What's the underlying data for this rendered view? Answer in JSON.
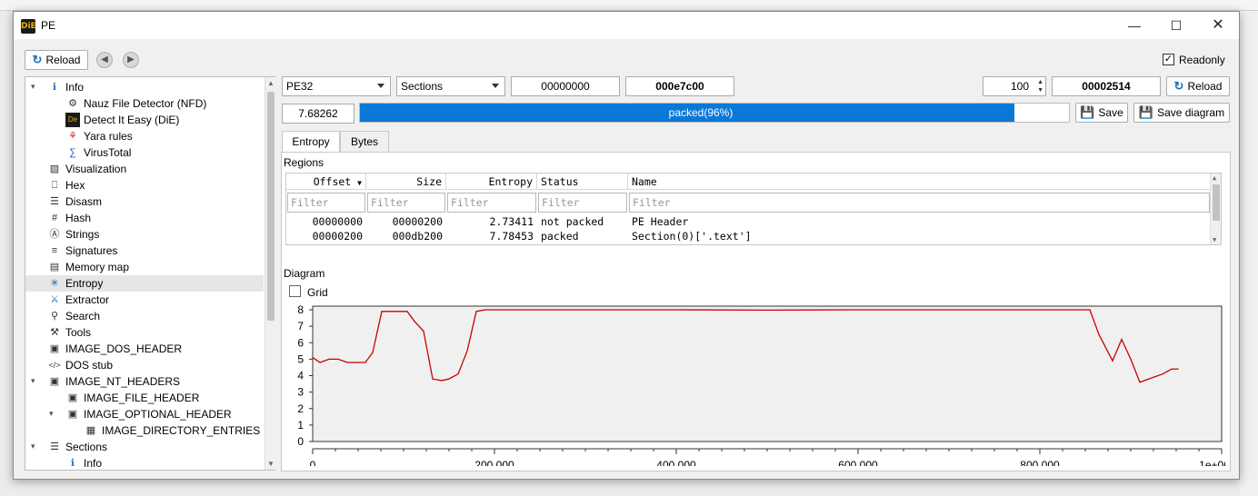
{
  "window": {
    "title": "PE",
    "icon_text": "DiE"
  },
  "toolbar": {
    "reload_label": "Reload",
    "readonly_label": "Readonly",
    "readonly_checked": true
  },
  "tree": {
    "items": [
      {
        "label": "Info",
        "icon": "info-icon"
      },
      {
        "label": "Nauz File Detector (NFD)",
        "icon": "nfd-icon"
      },
      {
        "label": "Detect It Easy (DiE)",
        "icon": "die-icon"
      },
      {
        "label": "Yara rules",
        "icon": "yara-icon"
      },
      {
        "label": "VirusTotal",
        "icon": "virustotal-icon"
      },
      {
        "label": "Visualization",
        "icon": "image-icon"
      },
      {
        "label": "Hex",
        "icon": "hex-icon"
      },
      {
        "label": "Disasm",
        "icon": "disasm-icon"
      },
      {
        "label": "Hash",
        "icon": "hash-icon"
      },
      {
        "label": "Strings",
        "icon": "strings-icon"
      },
      {
        "label": "Signatures",
        "icon": "signatures-icon"
      },
      {
        "label": "Memory map",
        "icon": "memory-map-icon"
      },
      {
        "label": "Entropy",
        "icon": "entropy-icon"
      },
      {
        "label": "Extractor",
        "icon": "extractor-icon"
      },
      {
        "label": "Search",
        "icon": "search-icon"
      },
      {
        "label": "Tools",
        "icon": "wrench-icon"
      },
      {
        "label": "IMAGE_DOS_HEADER",
        "icon": "header-icon"
      },
      {
        "label": "DOS stub",
        "icon": "code-icon"
      },
      {
        "label": "IMAGE_NT_HEADERS",
        "icon": "header-icon"
      },
      {
        "label": "IMAGE_FILE_HEADER",
        "icon": "header-icon"
      },
      {
        "label": "IMAGE_OPTIONAL_HEADER",
        "icon": "header-icon"
      },
      {
        "label": "IMAGE_DIRECTORY_ENTRIES",
        "icon": "table-icon"
      },
      {
        "label": "Sections",
        "icon": "sections-icon"
      },
      {
        "label": "Info",
        "icon": "info-icon"
      }
    ],
    "selected": "Entropy"
  },
  "controls": {
    "type_value": "PE32",
    "mode_value": "Sections",
    "offset_value": "00000000",
    "size_value": "000e7c00",
    "count_value": "100",
    "block_value": "00002514",
    "reload_label": "Reload",
    "entropy_value": "7.68262",
    "progress_label": "packed(96%)",
    "progress_percent": 96,
    "save_label": "Save",
    "save_diagram_label": "Save diagram"
  },
  "tabs": [
    {
      "label": "Entropy",
      "active": true
    },
    {
      "label": "Bytes",
      "active": false
    }
  ],
  "regions": {
    "label": "Regions",
    "columns": [
      "Offset",
      "Size",
      "Entropy",
      "Status",
      "Name"
    ],
    "filter_placeholder": "Filter",
    "rows": [
      {
        "offset": "00000000",
        "size": "00000200",
        "entropy": "2.73411",
        "status": "not packed",
        "name": "PE Header"
      },
      {
        "offset": "00000200",
        "size": "000db200",
        "entropy": "7.78453",
        "status": "packed",
        "name": "Section(0)['.text']"
      }
    ]
  },
  "diagram": {
    "label": "Diagram",
    "grid_label": "Grid",
    "grid_checked": false
  },
  "chart_data": {
    "type": "line",
    "title": "",
    "xlabel": "",
    "ylabel": "",
    "xlim": [
      0,
      1000000
    ],
    "ylim": [
      0,
      8
    ],
    "x_tick_labels": [
      "0",
      "200.000",
      "400.000",
      "600.000",
      "800.000",
      "1e+06"
    ],
    "x_tick_values": [
      0,
      200000,
      400000,
      600000,
      800000,
      1000000
    ],
    "y_tick_labels": [
      "0",
      "1",
      "2",
      "3",
      "4",
      "5",
      "6",
      "7",
      "8"
    ],
    "grid": false,
    "line_color": "#cc0000",
    "series": [
      {
        "x": [
          0,
          8000,
          18000,
          28000,
          38000,
          48000,
          58000,
          66000,
          76000,
          86000,
          96000,
          104000,
          112000,
          122000,
          132000,
          142000,
          150000,
          160000,
          170000,
          180000,
          190000,
          300000,
          400000,
          500000,
          600000,
          700000,
          800000,
          855000,
          865000,
          880000,
          890000,
          900000,
          910000,
          920000,
          935000,
          945000,
          952000
        ],
        "y": [
          5.1,
          4.8,
          5.0,
          5.0,
          4.8,
          4.8,
          4.8,
          5.4,
          7.9,
          7.9,
          7.9,
          7.9,
          7.3,
          6.7,
          3.8,
          3.7,
          3.8,
          4.1,
          5.5,
          7.9,
          8.0,
          8.0,
          8.0,
          7.98,
          8.0,
          8.0,
          8.0,
          8.0,
          6.5,
          4.9,
          6.2,
          5.0,
          3.6,
          3.8,
          4.1,
          4.4,
          4.4
        ]
      }
    ]
  }
}
